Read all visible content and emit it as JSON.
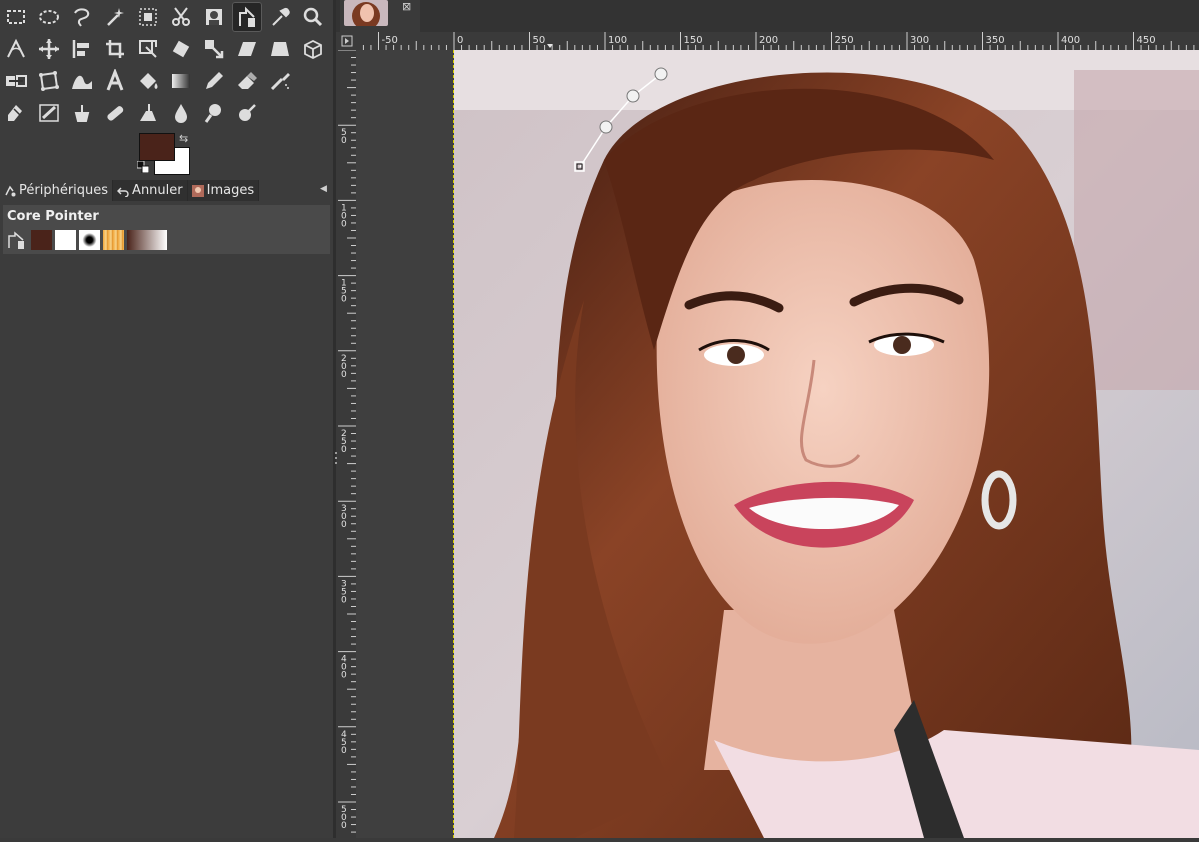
{
  "toolbox": {
    "tools": [
      {
        "name": "rect-select-icon"
      },
      {
        "name": "ellipse-select-icon"
      },
      {
        "name": "free-select-icon"
      },
      {
        "name": "fuzzy-select-icon"
      },
      {
        "name": "select-by-color-icon"
      },
      {
        "name": "scissors-select-icon"
      },
      {
        "name": "foreground-select-icon"
      },
      {
        "name": "paths-tool-icon",
        "active": true
      },
      {
        "name": "color-picker-icon"
      },
      {
        "name": "zoom-icon"
      },
      {
        "name": "measure-icon"
      },
      {
        "name": "move-icon"
      },
      {
        "name": "align-icon"
      },
      {
        "name": "crop-icon"
      },
      {
        "name": "unified-transform-icon"
      },
      {
        "name": "rotate-icon"
      },
      {
        "name": "scale-icon"
      },
      {
        "name": "shear-icon"
      },
      {
        "name": "perspective-icon"
      },
      {
        "name": "3d-transform-icon"
      },
      {
        "name": "flip-icon"
      },
      {
        "name": "cage-transform-icon"
      },
      {
        "name": "warp-transform-icon"
      },
      {
        "name": "text-tool-icon"
      },
      {
        "name": "bucket-fill-icon"
      },
      {
        "name": "gradient-icon"
      },
      {
        "name": "pencil-icon"
      },
      {
        "name": "eraser-icon"
      },
      {
        "name": "airbrush-icon"
      },
      {
        "name": "ink-icon"
      },
      {
        "name": "mypaint-brush-icon"
      },
      {
        "name": "clone-icon"
      },
      {
        "name": "heal-icon"
      },
      {
        "name": "perspective-clone-icon"
      },
      {
        "name": "blur-icon"
      },
      {
        "name": "smudge-icon"
      },
      {
        "name": "dodge-burn-icon"
      }
    ],
    "colors": {
      "foreground": "#4a231a",
      "background": "#ffffff"
    }
  },
  "dock": {
    "tabs": [
      {
        "label": "Périphériques",
        "icon": "devices-icon",
        "active": true
      },
      {
        "label": "Annuler",
        "icon": "undo-icon",
        "active": false
      },
      {
        "label": "Images",
        "icon": "images-icon",
        "active": false
      }
    ],
    "device_title": "Core Pointer",
    "device_swatches": [
      "#4a231a",
      "#ffffff",
      "brush",
      "pattern",
      "gradient"
    ]
  },
  "ruler": {
    "top_labels": [
      "-50",
      "0",
      "50",
      "100",
      "150",
      "200",
      "250",
      "300",
      "350",
      "400",
      "450"
    ],
    "left_labels": [
      "50",
      "100",
      "150",
      "200",
      "250",
      "300",
      "350",
      "400",
      "450",
      "500"
    ]
  },
  "canvas": {
    "guide_color": "#d8d000",
    "path_stroke_color": "#ffffff"
  }
}
